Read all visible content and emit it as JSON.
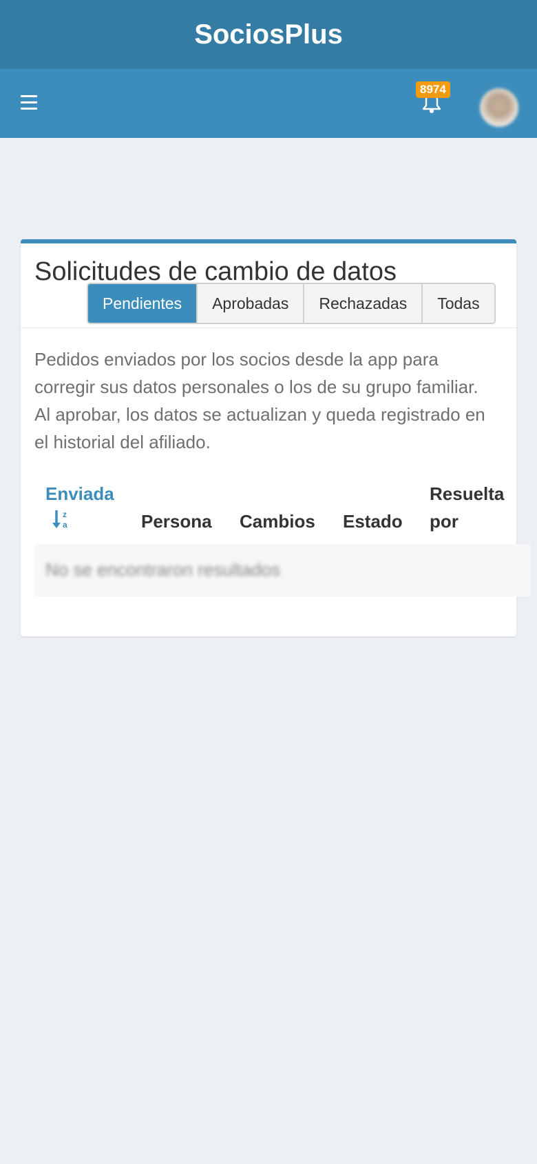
{
  "app": {
    "title": "SociosPlus"
  },
  "navbar": {
    "menu_icon": "hamburger-menu-icon",
    "notifications": {
      "icon": "bell-icon",
      "count": "8974",
      "badge_color": "#f39c12"
    },
    "avatar": "user-avatar"
  },
  "colors": {
    "header": "#357ca5",
    "navbar": "#3c8dbc",
    "accent": "#3c8dbc",
    "background": "#eceff3"
  },
  "panel": {
    "title": "Solicitudes de cambio de datos",
    "tabs": [
      {
        "label": "Pendientes",
        "active": true
      },
      {
        "label": "Aprobadas",
        "active": false
      },
      {
        "label": "Rechazadas",
        "active": false
      },
      {
        "label": "Todas",
        "active": false
      }
    ],
    "description": "Pedidos enviados por los socios desde la app para corregir sus datos personales o los de su grupo familiar. Al aprobar, los datos se actualizan y queda registrado en el historial del afiliado.",
    "table": {
      "columns": [
        {
          "label": "Enviada",
          "sort_icon": "sort-alpha-desc-icon",
          "sorted": true
        },
        {
          "label": "Persona"
        },
        {
          "label": "Cambios"
        },
        {
          "label": "Estado"
        },
        {
          "label": "Resuelta por"
        }
      ],
      "empty_message": "No se encontraron resultados"
    }
  }
}
